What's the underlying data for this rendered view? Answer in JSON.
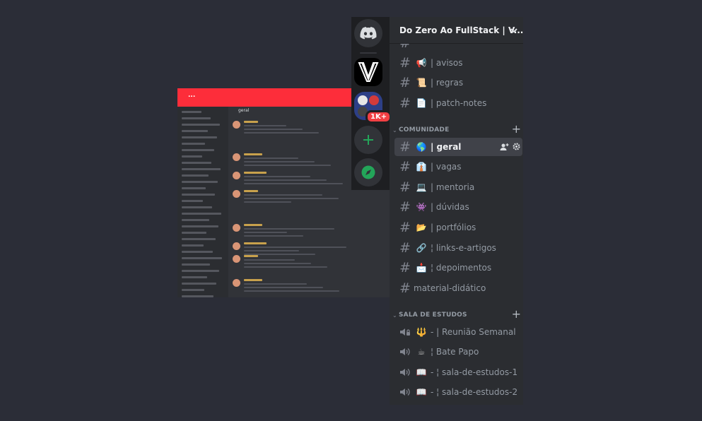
{
  "background_screenshot": {
    "banner_text": "...",
    "channel_header": "geral"
  },
  "rail": {
    "home_icon": "discord-logo-icon",
    "server_1_icon": "v-logo-icon",
    "server_2_badge": "1K+",
    "add_icon": "plus-icon",
    "explore_icon": "compass-icon"
  },
  "server": {
    "name": "Do Zero Ao FullStack | V...",
    "chevron_icon": "chevron-down-icon"
  },
  "channels_top": [
    {
      "emoji": "📢",
      "label": "| avisos"
    },
    {
      "emoji": "📜",
      "label": "| regras"
    },
    {
      "emoji": "📄",
      "label": "| patch-notes"
    }
  ],
  "category_comunidade": {
    "label": "COMUNIDADE",
    "chevron": "⌄"
  },
  "channels_comunidade": [
    {
      "emoji": "🌎",
      "label": "| geral",
      "active": true
    },
    {
      "emoji": "👔",
      "label": "| vagas"
    },
    {
      "emoji": "💻",
      "label": "| mentoria"
    },
    {
      "emoji": "👾",
      "label": "| dúvidas"
    },
    {
      "emoji": "📂",
      "label": "| portfólios"
    },
    {
      "emoji": "🔗",
      "label": "¦ links-e-artigos"
    },
    {
      "emoji": "📩",
      "label": "¦ depoimentos"
    },
    {
      "emoji": "",
      "label": "material-didático"
    }
  ],
  "category_sala": {
    "label": "SALA DE ESTUDOS",
    "chevron": "⌄"
  },
  "voice_channels": [
    {
      "emoji": "🔱",
      "label": "- | Reunião Semanal",
      "locked": true
    },
    {
      "emoji": "☕",
      "label": "¦ Bate Papo"
    },
    {
      "emoji": "📖",
      "label": "- ¦ sala-de-estudos-1"
    },
    {
      "emoji": "📖",
      "label": "- ¦ sala-de-estudos-2"
    }
  ],
  "colors": {
    "background": "#2b2d37",
    "rail": "#1e1f22",
    "panel": "#2b2d31",
    "active": "#404249",
    "green": "#23a559",
    "badge": "#f23f43",
    "banner": "#fd2d3a"
  }
}
